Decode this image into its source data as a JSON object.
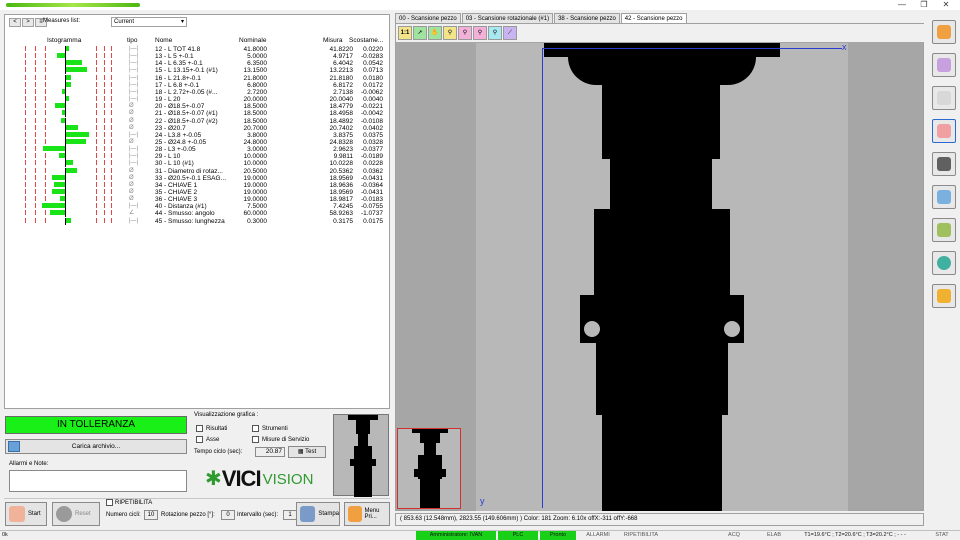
{
  "window": {
    "controls": [
      "—",
      "❐",
      "✕"
    ]
  },
  "measures": {
    "nav": [
      "<",
      ">",
      "≡"
    ],
    "list_label": "Measures list:",
    "list_value": "Current",
    "headers": [
      "Istogramma",
      "tipo",
      "Nome",
      "Nominale",
      "Misura",
      "Scostame..."
    ],
    "rows": [
      {
        "name": "12 - L TOT 41.8",
        "nominal": "41.8000",
        "measured": "41.8220",
        "deviation": "0.0220",
        "tipo": "|—|",
        "histogram": 0.022
      },
      {
        "name": "13 - L 5 +-0.1",
        "nominal": "5.0000",
        "measured": "4.9717",
        "deviation": "-0.0283",
        "tipo": "|—|",
        "histogram": -0.283
      },
      {
        "name": "14 - L 6.35 +-0.1",
        "nominal": "6.3500",
        "measured": "6.4042",
        "deviation": "0.0542",
        "tipo": "|—|",
        "histogram": 0.542
      },
      {
        "name": "15 - L 13.15+-0.1 (#1)",
        "nominal": "13.1500",
        "measured": "13.2213",
        "deviation": "0.0713",
        "tipo": "|—|",
        "histogram": 0.713
      },
      {
        "name": "16 - L 21.8+-0.1",
        "nominal": "21.8000",
        "measured": "21.8180",
        "deviation": "0.0180",
        "tipo": "|—|",
        "histogram": 0.18
      },
      {
        "name": "17 - L 6.8 +-0.1",
        "nominal": "6.8000",
        "measured": "6.8172",
        "deviation": "0.0172",
        "tipo": "|—|",
        "histogram": 0.172
      },
      {
        "name": "18 - L 2.72+-0.05   (#...",
        "nominal": "2.7200",
        "measured": "2.7138",
        "deviation": "-0.0062",
        "tipo": "|—|",
        "histogram": -0.06
      },
      {
        "name": "19 - L 20",
        "nominal": "20.0000",
        "measured": "20.0040",
        "deviation": "0.0040",
        "tipo": "|—|",
        "histogram": 0.04
      },
      {
        "name": "20 - Ø18.5+-0.07",
        "nominal": "18.5000",
        "measured": "18.4779",
        "deviation": "-0.0221",
        "tipo": "Ø",
        "histogram": -0.32
      },
      {
        "name": "21 - Ø18.5+-0.07 (#1)",
        "nominal": "18.5000",
        "measured": "18.4958",
        "deviation": "-0.0042",
        "tipo": "Ø",
        "histogram": -0.06
      },
      {
        "name": "22 - Ø18.5+-0.07 (#2)",
        "nominal": "18.5000",
        "measured": "18.4892",
        "deviation": "-0.0108",
        "tipo": "Ø",
        "histogram": -0.15
      },
      {
        "name": "23 - Ø20.7",
        "nominal": "20.7000",
        "measured": "20.7402",
        "deviation": "0.0402",
        "tipo": "Ø",
        "histogram": 0.4
      },
      {
        "name": "24 - L3.8 +-0.05",
        "nominal": "3.8000",
        "measured": "3.8375",
        "deviation": "0.0375",
        "tipo": "|—|",
        "histogram": 0.75
      },
      {
        "name": "25 - Ø24.8 +-0.05",
        "nominal": "24.8000",
        "measured": "24.8328",
        "deviation": "0.0328",
        "tipo": "Ø",
        "histogram": 0.66
      },
      {
        "name": "28 - L3 +-0.05",
        "nominal": "3.0000",
        "measured": "2.9623",
        "deviation": "-0.0377",
        "tipo": "|—|",
        "histogram": -0.75
      },
      {
        "name": "29 - L 10",
        "nominal": "10.0000",
        "measured": "9.9811",
        "deviation": "-0.0189",
        "tipo": "|—|",
        "histogram": -0.19
      },
      {
        "name": "30 - L 10 (#1)",
        "nominal": "10.0000",
        "measured": "10.0228",
        "deviation": "0.0228",
        "tipo": "|—|",
        "histogram": 0.23
      },
      {
        "name": "31 - Diametro di rotaz...",
        "nominal": "20.5000",
        "measured": "20.5362",
        "deviation": "0.0362",
        "tipo": "Ø",
        "histogram": 0.36
      },
      {
        "name": "33 - Ø20.5+-0.1 ESAG...",
        "nominal": "19.0000",
        "measured": "18.9569",
        "deviation": "-0.0431",
        "tipo": "Ø",
        "histogram": -0.43
      },
      {
        "name": "34 - CHIAVE 1",
        "nominal": "19.0000",
        "measured": "18.9636",
        "deviation": "-0.0364",
        "tipo": "Ø",
        "histogram": -0.36
      },
      {
        "name": "35 - CHIAVE 2",
        "nominal": "19.0000",
        "measured": "18.9569",
        "deviation": "-0.0431",
        "tipo": "Ø",
        "histogram": -0.43
      },
      {
        "name": "36 - CHIAVE 3",
        "nominal": "19.0000",
        "measured": "18.9817",
        "deviation": "-0.0183",
        "tipo": "Ø",
        "histogram": -0.18
      },
      {
        "name": "40 - Distanza (#1)",
        "nominal": "7.5000",
        "measured": "7.4245",
        "deviation": "-0.0755",
        "tipo": "|—|",
        "histogram": -0.76
      },
      {
        "name": "44 - Smusso: angolo",
        "nominal": "60.0000",
        "measured": "58.9263",
        "deviation": "-1.0737",
        "tipo": "∠",
        "histogram": -0.5
      },
      {
        "name": "45 - Smusso: lunghezza",
        "nominal": "0.3000",
        "measured": "0.3175",
        "deviation": "0.0175",
        "tipo": "|—|",
        "histogram": 0.18
      }
    ]
  },
  "controls": {
    "status": "IN TOLLERANZA",
    "status_color": "#18f018",
    "load_button": "Carica archivio...",
    "alarms_label": "Allarmi e Note:",
    "vis_label": "Visualizzazione grafica :",
    "chk_risultati": "Risultati",
    "chk_strumenti": "Strumenti",
    "chk_asse": "Asse",
    "chk_misure": "Misure di Servizio",
    "tempo_label": "Tempo ciclo (sec):",
    "tempo_value": "20.87",
    "test_button": "Test",
    "logo_vici": "VICI",
    "logo_vision": "VISION"
  },
  "bottom": {
    "start": "Start",
    "reset": "Reset",
    "ripetibilita": "RIPETIBILITA",
    "numero_label": "Numero cicli:",
    "numero_value": "10",
    "rotazione_label": "Rotazione pezzo [°]:",
    "rotazione_value": "0",
    "intervallo_label": "Intervallo (sec):",
    "intervallo_value": "1",
    "stampa": "Stampa",
    "menu": "Menu Pri..."
  },
  "tabs": [
    {
      "label": "00 - Scansione pezzo",
      "active": false
    },
    {
      "label": "03 - Scansione rotazionale (#1)",
      "active": false
    },
    {
      "label": "38 - Scansione pezzo",
      "active": false
    },
    {
      "label": "42 - Scansione pezzo",
      "active": true
    }
  ],
  "viewer": {
    "scale_label": "1:1",
    "axis_x": "x",
    "axis_y": "y",
    "coords": "( 853.63 (12.548mm), 2823.55 (149.606mm) ) Color: 181   Zoom: 6.10x   offX:-311  offY:-668"
  },
  "statusbar": {
    "left": "0k",
    "user": "Amministratore: IVAN",
    "plc": "PLC",
    "ready": "Pronto",
    "allarmi": "ALLARMI",
    "ripetib": "RIPETIBILITA",
    "acq": "ACQ",
    "elab": "ELAB",
    "temps": "T1=19.6°C ; T2=20.6°C ; T3=20.2°C ; - - -",
    "stat": "STAT"
  },
  "colors": {
    "accent_green": "#18e418",
    "axis_blue": "#2a3cd0"
  }
}
